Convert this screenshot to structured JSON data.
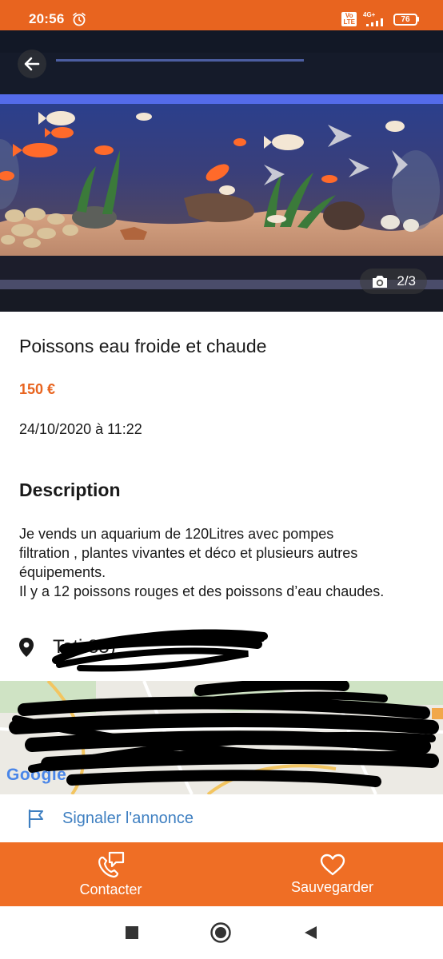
{
  "status_bar": {
    "time": "20:56",
    "volte_label": "Vo\nLTE",
    "network_label": "4G+",
    "battery": "76"
  },
  "gallery": {
    "counter": "2/3"
  },
  "listing": {
    "title": "Poissons eau froide et chaude",
    "price": "150 €",
    "date": "24/10/2020 à 11:22"
  },
  "description": {
    "heading": "Description",
    "lines": [
      "Je vends un aquarium de 120Litres avec pompes",
      "filtration , plantes vivantes et déco et plusieurs autres",
      "équipements.",
      "Il y a 12 poissons rouges et des poissons d’eau chaudes."
    ]
  },
  "location": {
    "text": "Toti                           85)"
  },
  "map": {
    "provider": "Google"
  },
  "report": {
    "label": "Signaler l'annonce"
  },
  "actions": {
    "contact_label": "Contacter",
    "save_label": "Sauvegarder"
  },
  "colors": {
    "brand_orange": "#e8641f",
    "action_bar": "#ef6e25",
    "link_blue": "#3e7fc1"
  }
}
